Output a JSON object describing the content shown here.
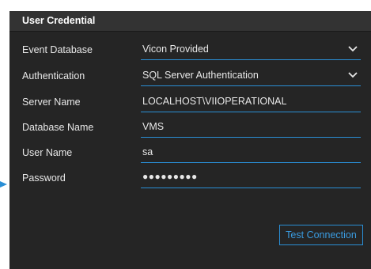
{
  "panel": {
    "title": "User Credential"
  },
  "fields": [
    {
      "label": "Event Database",
      "value": "Vicon Provided",
      "kind": "dropdown"
    },
    {
      "label": "Authentication",
      "value": "SQL Server Authentication",
      "kind": "dropdown"
    },
    {
      "label": "Server Name",
      "value": "LOCALHOST\\VIIOPERATIONAL",
      "kind": "text"
    },
    {
      "label": "Database Name",
      "value": "VMS",
      "kind": "text"
    },
    {
      "label": "User Name",
      "value": "sa",
      "kind": "text"
    },
    {
      "label": "Password",
      "value": "●●●●●●●●●",
      "kind": "password"
    }
  ],
  "actions": {
    "test_connection_label": "Test Connection"
  },
  "icons": {
    "dropdown": "chevron-down-icon",
    "pointer": "arrow-tip-icon"
  },
  "colors": {
    "panel_background": "#252525",
    "header_background": "#333333",
    "accent": "#2a8fd6",
    "text": "#e8e8e8"
  }
}
